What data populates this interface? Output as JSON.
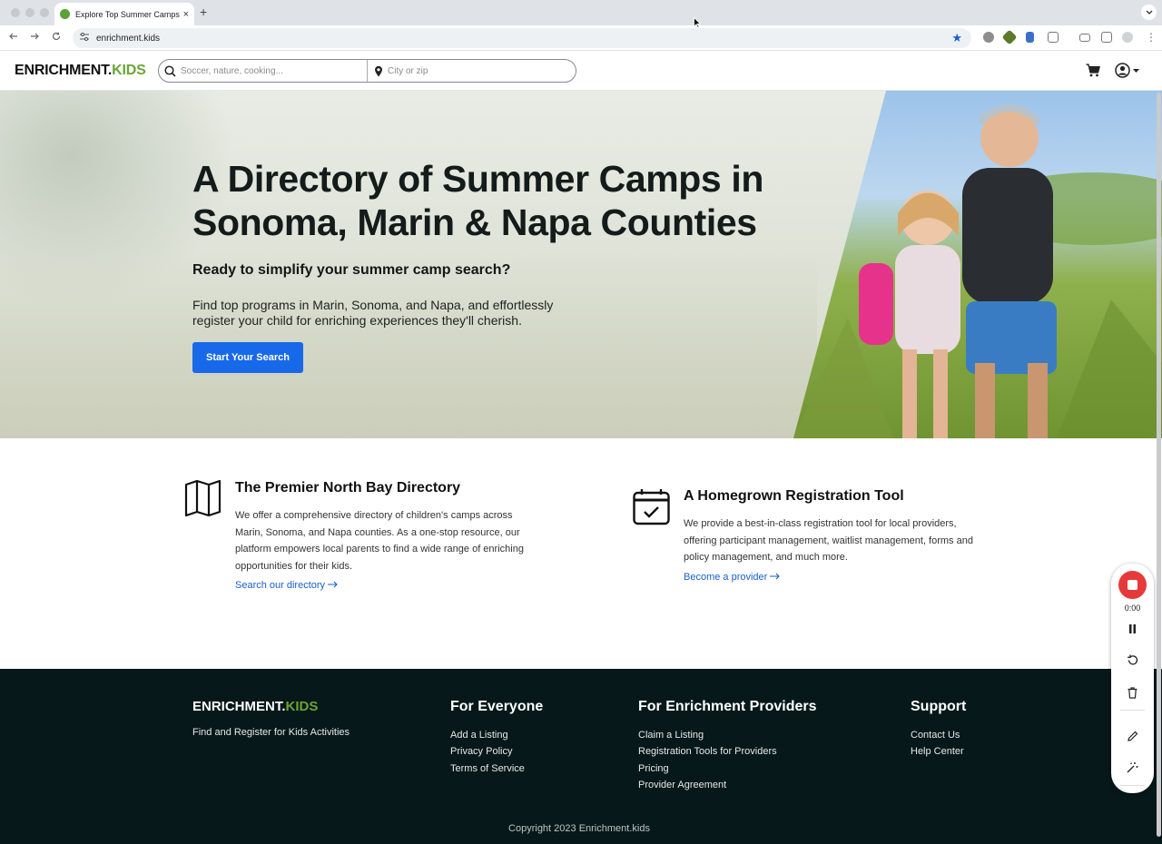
{
  "browser": {
    "tab_title": "Explore Top Summer Camps",
    "tab_close": "×",
    "new_tab": "+",
    "url": "enrichment.kids"
  },
  "header": {
    "logo_main": "ENRICHMENT.",
    "logo_accent": "KIDS",
    "search_placeholder": "Soccer, nature, cooking...",
    "location_placeholder": "City or zip"
  },
  "hero": {
    "title": "A Directory of Summer Camps in Sonoma, Marin & Napa Counties",
    "subtitle": "Ready to simplify your summer camp search?",
    "description": "Find top programs in Marin, Sonoma, and Napa, and effortlessly register your child for enriching experiences they'll cherish.",
    "cta_label": "Start Your Search"
  },
  "features": [
    {
      "title": "The Premier North Bay Directory",
      "body": "We offer a comprehensive directory of children's camps across Marin, Sonoma, and Napa counties. As a one-stop resource, our platform empowers local parents to find a wide range of enriching opportunities for their kids.",
      "link": "Search our directory",
      "icon": "map-icon"
    },
    {
      "title": "A Homegrown Registration Tool",
      "body": "We provide a best-in-class registration tool for local providers, offering participant management, waitlist management, forms and policy management, and much more.",
      "link": "Become a provider",
      "icon": "calendar-check-icon"
    }
  ],
  "footer": {
    "logo_main": "ENRICHMENT.",
    "logo_accent": "KIDS",
    "tagline": "Find and Register for Kids Activities",
    "columns": [
      {
        "heading": "For Everyone",
        "links": [
          "Add a Listing",
          "Privacy Policy",
          "Terms of Service"
        ]
      },
      {
        "heading": "For Enrichment Providers",
        "links": [
          "Claim a Listing",
          "Registration Tools for Providers",
          "Pricing",
          "Provider Agreement"
        ]
      },
      {
        "heading": "Support",
        "links": [
          "Contact Us",
          "Help Center"
        ]
      }
    ],
    "copyright": "Copyright 2023 Enrichment.kids"
  },
  "recorder": {
    "time": "0:00"
  },
  "colors": {
    "brand_green": "#6aa534",
    "cta_blue": "#1769ea",
    "link_blue": "#1a5fd0",
    "footer_bg": "#06181a",
    "record_red": "#e63a3a"
  }
}
